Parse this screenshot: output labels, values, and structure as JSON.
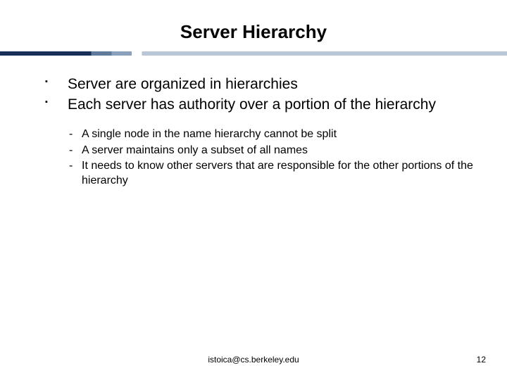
{
  "title": "Server Hierarchy",
  "bullets": [
    "Server are organized in hierarchies",
    "Each server has authority over a portion of the hierarchy"
  ],
  "sub_bullets": [
    "A single node in the name hierarchy cannot be split",
    "A server maintains only a subset of all names",
    "It needs to know other servers that are responsible for the other portions of the hierarchy"
  ],
  "footer": {
    "email": "istoica@cs.berkeley.edu",
    "page_number": "12"
  }
}
